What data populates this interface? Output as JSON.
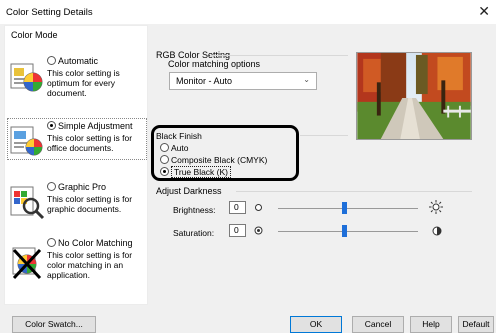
{
  "window": {
    "title": "Color Setting Details",
    "close_glyph": "✕"
  },
  "color_mode": {
    "label": "Color Mode",
    "modes": [
      {
        "label": "Automatic",
        "desc": "This color setting is optimum for every document.",
        "selected": false,
        "icon": "auto-mode-icon"
      },
      {
        "label": "Simple Adjustment",
        "desc": "This color setting is for office documents.",
        "selected": true,
        "icon": "simple-adjustment-icon"
      },
      {
        "label": "Graphic Pro",
        "desc": "This color setting is for graphic documents.",
        "selected": false,
        "icon": "graphic-pro-icon"
      },
      {
        "label": "No Color Matching",
        "desc": "This color setting is for color matching in an application.",
        "selected": false,
        "icon": "no-color-matching-icon"
      }
    ]
  },
  "rgb": {
    "label": "RGB Color Setting",
    "matching_label": "Color matching options",
    "matching_value": "Monitor - Auto",
    "arrow": "⌄"
  },
  "black_finish": {
    "label": "Black Finish",
    "options": [
      {
        "label": "Auto",
        "selected": false
      },
      {
        "label": "Composite Black (CMYK)",
        "selected": false
      },
      {
        "label": "True Black (K)",
        "selected": true
      }
    ]
  },
  "adjust_darkness": {
    "label": "Adjust Darkness",
    "brightness": {
      "label": "Brightness:",
      "value": "0"
    },
    "saturation": {
      "label": "Saturation:",
      "value": "0"
    }
  },
  "buttons": {
    "swatch": "Color Swatch...",
    "ok": "OK",
    "cancel": "Cancel",
    "help": "Help",
    "default": "Default"
  }
}
